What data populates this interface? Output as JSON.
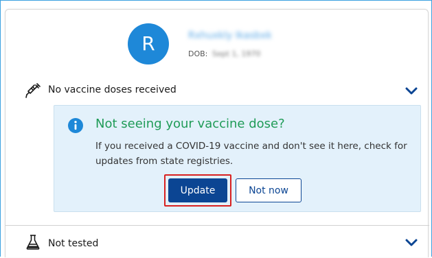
{
  "profile": {
    "avatar_initial": "R",
    "name": "Rxhuxkly Ikasbxk",
    "dob_label": "DOB:",
    "dob_value": "Sept 1, 1970"
  },
  "vaccine_section": {
    "label": "No vaccine doses received",
    "icon": "syringe-icon",
    "expand_icon": "chevron-down-icon"
  },
  "notice": {
    "icon": "info-icon",
    "title": "Not seeing your vaccine dose?",
    "body": "If you received a COVID-19 vaccine and don't see it here, check for updates from state registries.",
    "update_label": "Update",
    "not_now_label": "Not now"
  },
  "test_section": {
    "label": "Not tested",
    "icon": "flask-icon",
    "expand_icon": "chevron-down-icon"
  },
  "colors": {
    "avatar": "#1e88d8",
    "notice_bg": "#e3f1fb",
    "notice_title": "#1f9b57",
    "primary_button": "#0b4593",
    "chevron": "#0b4593",
    "highlight": "#d9201f",
    "frame_border": "#3aa0e0"
  }
}
